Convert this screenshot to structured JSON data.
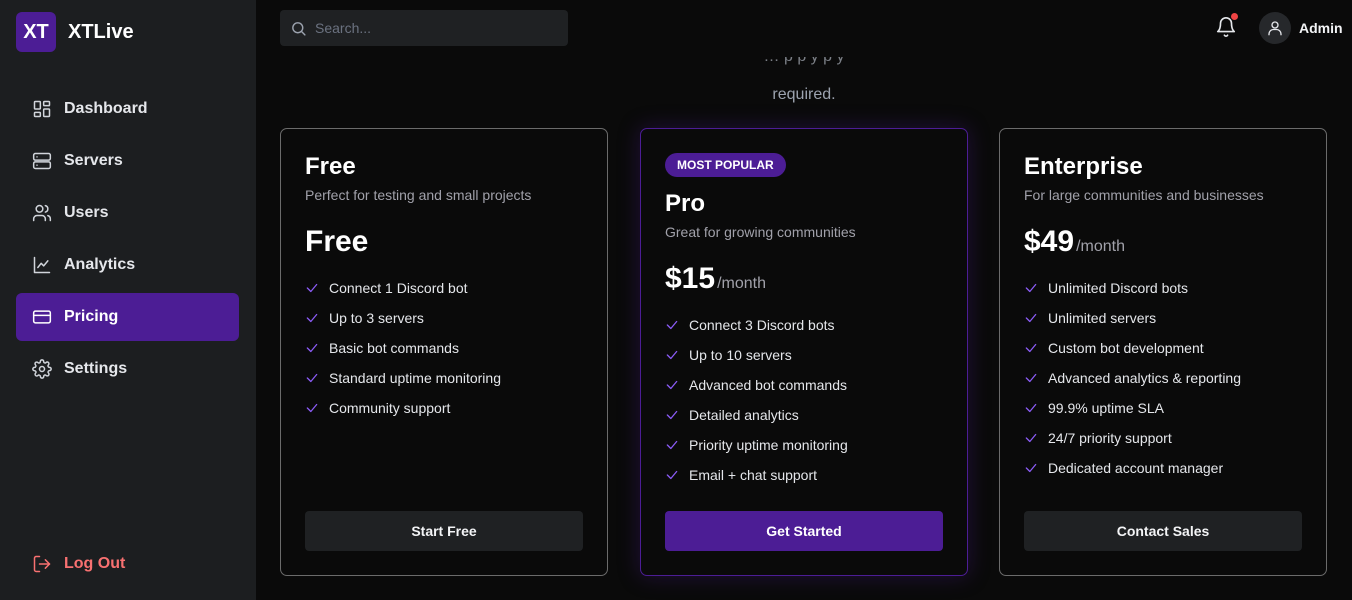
{
  "brand": {
    "logo": "XT",
    "name": "XTLive"
  },
  "sidebar": {
    "items": [
      {
        "label": "Dashboard",
        "icon": "dashboard-icon"
      },
      {
        "label": "Servers",
        "icon": "servers-icon"
      },
      {
        "label": "Users",
        "icon": "users-icon"
      },
      {
        "label": "Analytics",
        "icon": "analytics-icon"
      },
      {
        "label": "Pricing",
        "icon": "credit-card-icon",
        "active": true
      },
      {
        "label": "Settings",
        "icon": "gear-icon"
      }
    ],
    "logout_label": "Log Out"
  },
  "topbar": {
    "search_placeholder": "Search...",
    "has_notification": true,
    "user_name": "Admin"
  },
  "intro": {
    "partial_line": "… p   p   y                 p            y",
    "line": "required."
  },
  "plans": [
    {
      "name": "Free",
      "description": "Perfect for testing and small projects",
      "price": "Free",
      "period": "",
      "features": [
        "Connect 1 Discord bot",
        "Up to 3 servers",
        "Basic bot commands",
        "Standard uptime monitoring",
        "Community support"
      ],
      "cta": "Start Free"
    },
    {
      "badge": "MOST POPULAR",
      "name": "Pro",
      "description": "Great for growing communities",
      "price": "$15",
      "period": "/month",
      "features": [
        "Connect 3 Discord bots",
        "Up to 10 servers",
        "Advanced bot commands",
        "Detailed analytics",
        "Priority uptime monitoring",
        "Email + chat support"
      ],
      "cta": "Get Started"
    },
    {
      "name": "Enterprise",
      "description": "For large communities and businesses",
      "price": "$49",
      "period": "/month",
      "features": [
        "Unlimited Discord bots",
        "Unlimited servers",
        "Custom bot development",
        "Advanced analytics & reporting",
        "99.9% uptime SLA",
        "24/7 priority support",
        "Dedicated account manager"
      ],
      "cta": "Contact Sales"
    }
  ],
  "colors": {
    "accent": "#4c1d95",
    "check": "#8b5cf6",
    "danger": "#f87171",
    "notification": "#ef4444"
  }
}
